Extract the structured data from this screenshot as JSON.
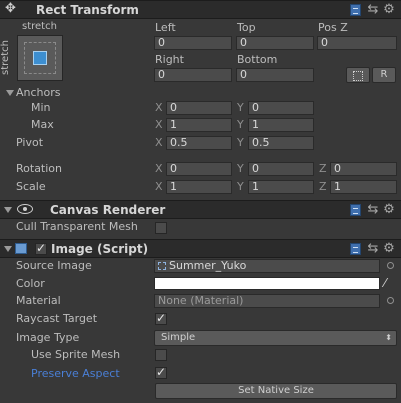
{
  "rect_transform": {
    "title": "Rect Transform",
    "anchor_preset_top_label": "stretch",
    "anchor_preset_side_label": "stretch",
    "col_left": "Left",
    "col_top": "Top",
    "col_posz": "Pos Z",
    "left_value": "0",
    "top_value": "0",
    "posz_value": "0",
    "col_right": "Right",
    "col_bottom": "Bottom",
    "right_value": "0",
    "bottom_value": "0",
    "raw_button": "R",
    "anchors_label": "Anchors",
    "min_label": "Min",
    "max_label": "Max",
    "pivot_label": "Pivot",
    "rotation_label": "Rotation",
    "scale_label": "Scale",
    "axis_x": "X",
    "axis_y": "Y",
    "axis_z": "Z",
    "min_x": "0",
    "min_y": "0",
    "max_x": "1",
    "max_y": "1",
    "pivot_x": "0.5",
    "pivot_y": "0.5",
    "rot_x": "0",
    "rot_y": "0",
    "rot_z": "0",
    "scale_x": "1",
    "scale_y": "1",
    "scale_z": "1"
  },
  "canvas_renderer": {
    "title": "Canvas Renderer",
    "cull_label": "Cull Transparent Mesh",
    "cull_checked": false
  },
  "image_script": {
    "title": "Image (Script)",
    "enabled": true,
    "source_image_label": "Source Image",
    "source_image_value": "Summer_Yuko",
    "color_label": "Color",
    "color_value": "#ffffff",
    "material_label": "Material",
    "material_value": "None (Material)",
    "raycast_label": "Raycast Target",
    "raycast_checked": true,
    "image_type_label": "Image Type",
    "image_type_value": "Simple",
    "use_sprite_mesh_label": "Use Sprite Mesh",
    "use_sprite_mesh_checked": false,
    "preserve_aspect_label": "Preserve Aspect",
    "preserve_aspect_checked": true,
    "set_native_size_button": "Set Native Size"
  },
  "colors": {
    "panel_bg": "#383838",
    "header_bg": "#2b2b2b",
    "highlight_label": "#4a7fd6"
  }
}
